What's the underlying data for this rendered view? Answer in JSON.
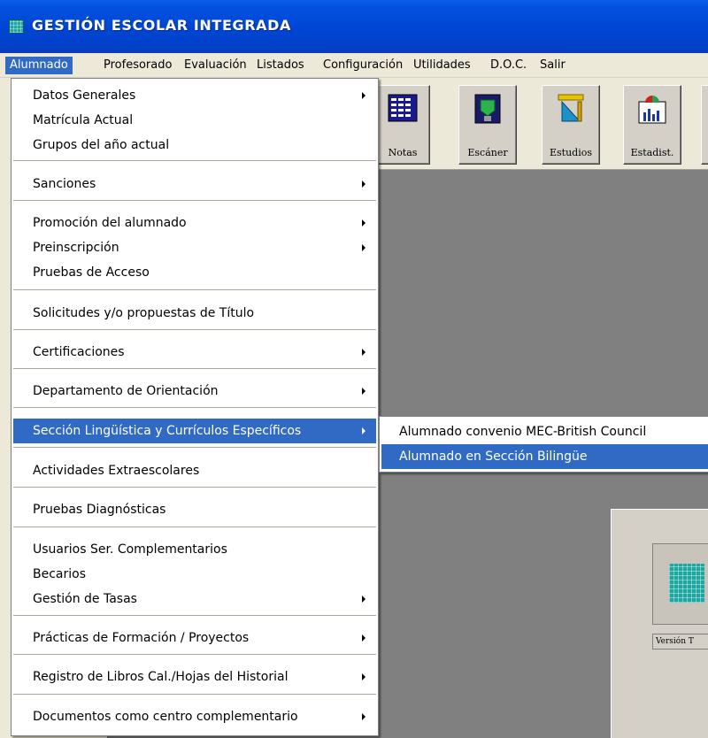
{
  "window": {
    "title": "GESTIÓN  ESCOLAR  INTEGRADA"
  },
  "menubar": [
    "Alumnado",
    "Profesorado",
    "Evaluación",
    "Listados",
    "Configuración",
    "Utilidades",
    "D.O.C.",
    "Salir"
  ],
  "toolbar": {
    "buttons": [
      {
        "label": "Notas",
        "icon": "grades-grid-icon"
      },
      {
        "label": "Escáner",
        "icon": "scanner-icon"
      },
      {
        "label": "Estudios",
        "icon": "ruler-pencil-icon"
      },
      {
        "label": "Estadist.",
        "icon": "statistics-chart-icon"
      }
    ]
  },
  "alumnado_menu": {
    "items": [
      {
        "label": "Datos Generales",
        "submenu": true
      },
      {
        "label": "Matrícula Actual",
        "submenu": false
      },
      {
        "label": "Grupos del año actual",
        "submenu": false
      },
      {
        "label": "Sanciones",
        "submenu": true
      },
      {
        "label": "Promoción del alumnado",
        "submenu": true
      },
      {
        "label": "Preinscripción",
        "submenu": true
      },
      {
        "label": "Pruebas de Acceso",
        "submenu": false
      },
      {
        "label": "Solicitudes y/o propuestas de Título",
        "submenu": false
      },
      {
        "label": "Certificaciones",
        "submenu": true
      },
      {
        "label": "Departamento de Orientación",
        "submenu": true
      },
      {
        "label": "Sección Lingüística y Currículos Específicos",
        "submenu": true,
        "highlighted": true
      },
      {
        "label": "Actividades Extraescolares",
        "submenu": false
      },
      {
        "label": "Pruebas Diagnósticas",
        "submenu": false
      },
      {
        "label": "Usuarios Ser. Complementarios",
        "submenu": false
      },
      {
        "label": "Becarios",
        "submenu": false
      },
      {
        "label": "Gestión de Tasas",
        "submenu": true
      },
      {
        "label": "Prácticas de Formación / Proyectos",
        "submenu": true
      },
      {
        "label": "Registro de Libros Cal./Hojas del Historial",
        "submenu": true
      },
      {
        "label": "Documentos como centro complementario",
        "submenu": true
      }
    ]
  },
  "seccion_submenu": {
    "items": [
      {
        "label": "Alumnado convenio MEC-British Council"
      },
      {
        "label": "Alumnado en Sección Bilingüe",
        "highlighted": true
      }
    ]
  },
  "about_panel": {
    "version_text": "Versión T"
  }
}
